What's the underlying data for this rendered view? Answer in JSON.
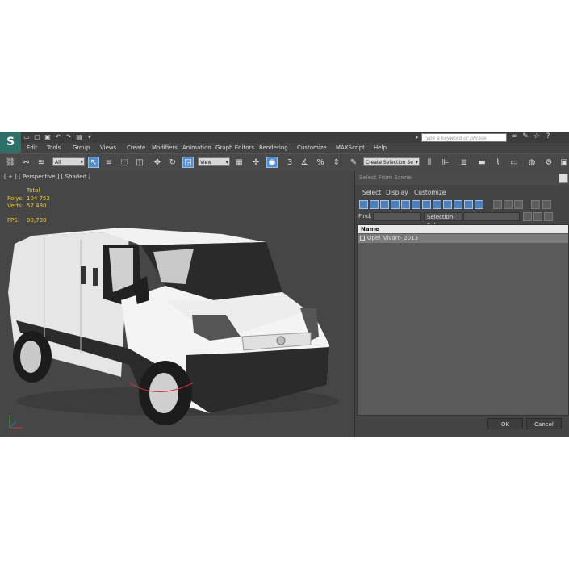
{
  "title_bar": {
    "logo_text": "S",
    "search_placeholder": "Type a keyword or phrase"
  },
  "menu": [
    "Edit",
    "Tools",
    "Group",
    "Views",
    "Create",
    "Modifiers",
    "Animation",
    "Graph Editors",
    "Rendering",
    "Customize",
    "MAXScript",
    "Help"
  ],
  "toolbar": {
    "filter_value": "All",
    "ref_coord_value": "View",
    "selection_set_value": "Create Selection Se"
  },
  "viewport": {
    "label": "[ + ] [ Perspective ] [ Shaded ]",
    "stats": {
      "header": "Total",
      "polys_label": "Polys:",
      "polys_value": "104 752",
      "verts_label": "Verts:",
      "verts_value": "57 480",
      "fps_label": "FPS:",
      "fps_value": "90,738"
    }
  },
  "dialog": {
    "title": "Select From Scene",
    "menu": [
      "Select",
      "Display",
      "Customize"
    ],
    "find_label": "Find:",
    "selection_set_label": "Selection Set:",
    "column_name": "Name",
    "rows": [
      "Opel_Vivaro_2013"
    ],
    "ok_label": "OK",
    "cancel_label": "Cancel"
  }
}
